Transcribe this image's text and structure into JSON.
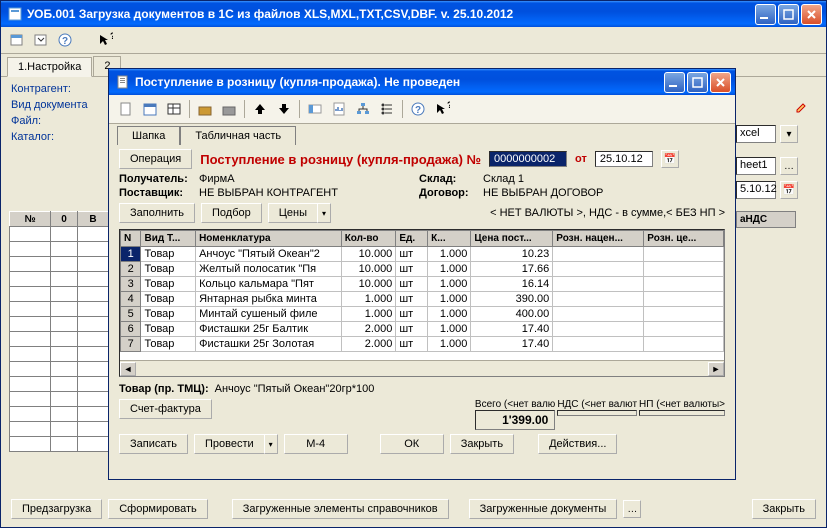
{
  "main": {
    "title": "УОБ.001 Загрузка документов в 1С из файлов XLS,MXL,TXT,CSV,DBF.  v. 25.10.2012",
    "tab1": "1.Настройка",
    "tab2": "2",
    "labels": {
      "contragent": "Контрагент:",
      "doc_type": "Вид документа",
      "file": "Файл:",
      "catalog": "Каталог:"
    },
    "right": {
      "format": "xcel",
      "sheet": "heet1",
      "date": "5.10.12"
    },
    "bg_headers": [
      "№",
      "0",
      "В"
    ],
    "right_headers": "аНДС",
    "footer": {
      "preload": "Предзагрузка",
      "form": "Сформировать",
      "loaded_dict": "Загруженные элементы справочников",
      "loaded_docs": "Загруженные документы",
      "close": "Закрыть"
    }
  },
  "dialog": {
    "title": "Поступление в розницу (купля-продажа). Не проведен",
    "tabs": {
      "header": "Шапка",
      "table": "Табличная часть"
    },
    "op_btn": "Операция",
    "op_title": "Поступление в розницу (купля-продажа) №",
    "doc_num": "0000000002",
    "from": "от",
    "date": "25.10.12",
    "info": {
      "recipient_k": "Получатель:",
      "recipient_v": "ФирмА",
      "supplier_k": "Поставщик:",
      "supplier_v": "НЕ ВЫБРАН КОНТРАГЕНТ",
      "warehouse_k": "Склад:",
      "warehouse_v": "Склад 1",
      "contract_k": "Договор:",
      "contract_v": "НЕ ВЫБРАН ДОГОВОР"
    },
    "sub": {
      "fill": "Заполнить",
      "select": "Подбор",
      "prices": "Цены",
      "nds_note": "< НЕТ ВАЛЮТЫ >, НДС - в сумме,< БЕЗ НП >"
    },
    "cols": [
      "N",
      "Вид Т...",
      "Номенклатура",
      "Кол-во",
      "Ед.",
      "К...",
      "Цена пост...",
      "Розн. нацен...",
      "Розн. це..."
    ],
    "rows": [
      {
        "n": 1,
        "type": "Товар",
        "nom": "Анчоус \"Пятый Океан\"2",
        "qty": "10.000",
        "unit": "шт",
        "k": "1.000",
        "price": "10.23",
        "mk": "",
        "rc": ""
      },
      {
        "n": 2,
        "type": "Товар",
        "nom": "Желтый полосатик \"Пя",
        "qty": "10.000",
        "unit": "шт",
        "k": "1.000",
        "price": "17.66",
        "mk": "",
        "rc": ""
      },
      {
        "n": 3,
        "type": "Товар",
        "nom": "Кольцо кальмара \"Пят",
        "qty": "10.000",
        "unit": "шт",
        "k": "1.000",
        "price": "16.14",
        "mk": "",
        "rc": ""
      },
      {
        "n": 4,
        "type": "Товар",
        "nom": "Янтарная рыбка минта",
        "qty": "1.000",
        "unit": "шт",
        "k": "1.000",
        "price": "390.00",
        "mk": "",
        "rc": ""
      },
      {
        "n": 5,
        "type": "Товар",
        "nom": "Минтай сушеный филе",
        "qty": "1.000",
        "unit": "шт",
        "k": "1.000",
        "price": "400.00",
        "mk": "",
        "rc": ""
      },
      {
        "n": 6,
        "type": "Товар",
        "nom": "Фисташки 25г Балтик",
        "qty": "2.000",
        "unit": "шт",
        "k": "1.000",
        "price": "17.40",
        "mk": "",
        "rc": ""
      },
      {
        "n": 7,
        "type": "Товар",
        "nom": "Фисташки 25г Золотая",
        "qty": "2.000",
        "unit": "шт",
        "k": "1.000",
        "price": "17.40",
        "mk": "",
        "rc": ""
      }
    ],
    "product_label": "Товар (пр. ТМЦ):",
    "product_value": "Анчоус \"Пятый Океан\"20гр*100",
    "invoice_btn": "Счет-фактура",
    "totals": {
      "t1_lbl": "Всего (<нет валю",
      "t1_val": "1'399.00",
      "t2_lbl": "НДС (<нет валют",
      "t3_lbl": "НП (<нет валюты>"
    },
    "footer": {
      "save": "Записать",
      "post": "Провести",
      "m4": "М-4",
      "ok": "ОК",
      "close": "Закрыть",
      "actions": "Действия..."
    }
  }
}
